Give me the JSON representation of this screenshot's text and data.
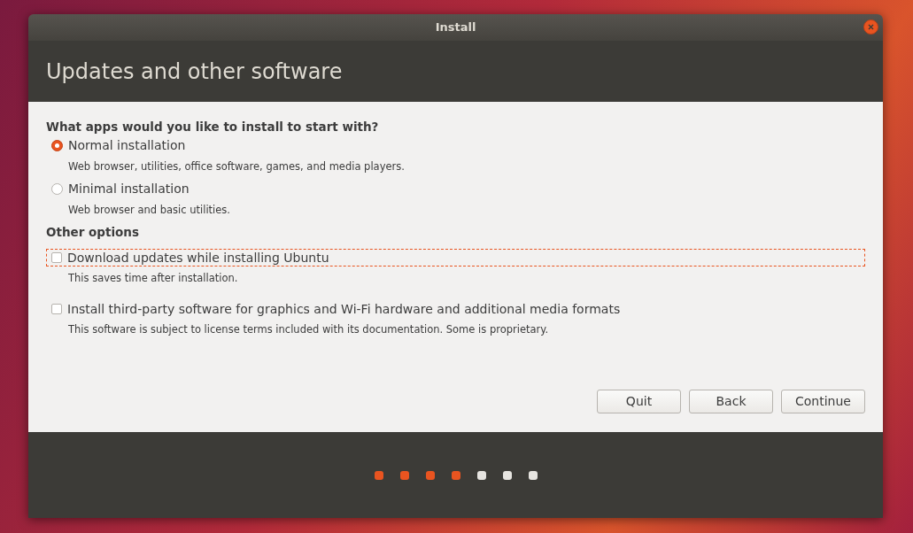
{
  "window": {
    "title": "Install"
  },
  "header": {
    "title": "Updates and other software"
  },
  "apps_section": {
    "heading": "What apps would you like to install to start with?",
    "options": [
      {
        "label": "Normal installation",
        "description": "Web browser, utilities, office software, games, and media players.",
        "selected": true
      },
      {
        "label": "Minimal installation",
        "description": "Web browser and basic utilities.",
        "selected": false
      }
    ]
  },
  "other_options": {
    "heading": "Other options",
    "options": [
      {
        "label": "Download updates while installing Ubuntu",
        "description": "This saves time after installation.",
        "checked": false,
        "focused": true
      },
      {
        "label": "Install third-party software for graphics and Wi-Fi hardware and additional media formats",
        "description": "This software is subject to license terms included with its documentation. Some is proprietary.",
        "checked": false,
        "focused": false
      }
    ]
  },
  "buttons": [
    "Quit",
    "Back",
    "Continue"
  ],
  "progress_steps": [
    {
      "completed": true
    },
    {
      "completed": true
    },
    {
      "completed": true
    },
    {
      "completed": true
    },
    {
      "completed": false
    },
    {
      "completed": false
    },
    {
      "completed": false
    }
  ]
}
